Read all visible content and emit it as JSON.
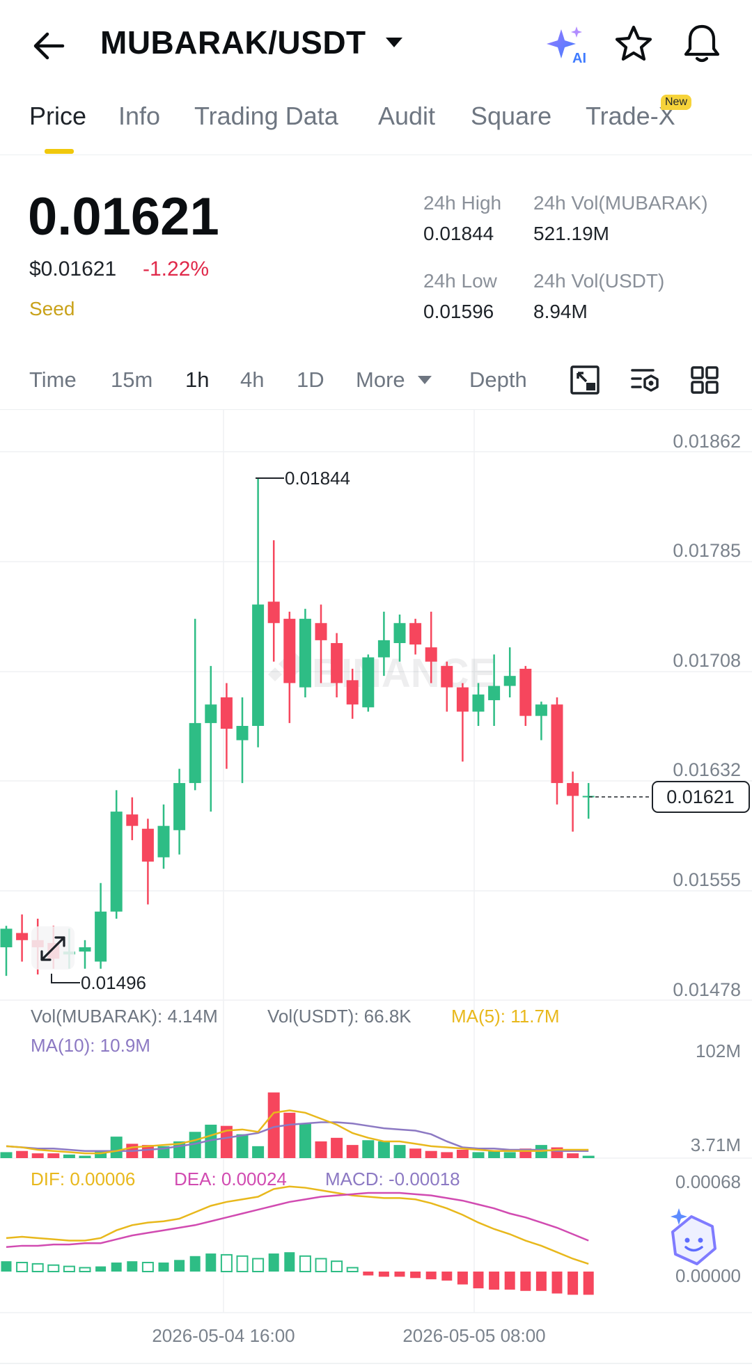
{
  "header": {
    "pair": "MUBARAK/USDT",
    "icons": {
      "back": "back-arrow-icon",
      "ai": "ai-sparkle-icon",
      "favorite": "star-icon",
      "alert": "bell-icon"
    }
  },
  "tabs": [
    {
      "label": "Price",
      "active": true
    },
    {
      "label": "Info"
    },
    {
      "label": "Trading Data"
    },
    {
      "label": "Audit"
    },
    {
      "label": "Square"
    },
    {
      "label": "Trade-X",
      "badge": "New"
    }
  ],
  "ticker": {
    "last_price": "0.01621",
    "usd_price": "$0.01621",
    "change": "-1.22%",
    "tag": "Seed",
    "high_label": "24h High",
    "high": "0.01844",
    "low_label": "24h Low",
    "low": "0.01596",
    "vol_base_label": "24h Vol(MUBARAK)",
    "vol_base": "521.19M",
    "vol_quote_label": "24h Vol(USDT)",
    "vol_quote": "8.94M"
  },
  "intervals": {
    "items": [
      "Time",
      "15m",
      "1h",
      "4h",
      "1D",
      "More"
    ],
    "active": "1h",
    "depth": "Depth",
    "tool_icons": [
      "chart-expand-icon",
      "indicator-settings-icon",
      "grid-layout-icon"
    ]
  },
  "colors": {
    "up": "#2ebd85",
    "down": "#f6465d",
    "ma5": "#e8b81c",
    "ma10": "#8c79c3",
    "dea": "#d14bb1",
    "accent": "#f0c80c"
  },
  "chart_data": {
    "type": "candlestick",
    "price_axis": [
      "0.01862",
      "0.01785",
      "0.01708",
      "0.01632",
      "0.01555",
      "0.01478"
    ],
    "ylim": [
      0.01478,
      0.01862
    ],
    "high_marker": "0.01844",
    "low_marker": "0.01496",
    "current_price": "0.01621",
    "candles": [
      {
        "o": 0.01515,
        "h": 0.0153,
        "l": 0.01495,
        "c": 0.01528
      },
      {
        "o": 0.01525,
        "h": 0.01538,
        "l": 0.01505,
        "c": 0.0152
      },
      {
        "o": 0.0152,
        "h": 0.01535,
        "l": 0.01496,
        "c": 0.01515
      },
      {
        "o": 0.01518,
        "h": 0.0153,
        "l": 0.015,
        "c": 0.01507
      },
      {
        "o": 0.0151,
        "h": 0.01528,
        "l": 0.015,
        "c": 0.01512
      },
      {
        "o": 0.01512,
        "h": 0.0152,
        "l": 0.015,
        "c": 0.01515
      },
      {
        "o": 0.01505,
        "h": 0.0156,
        "l": 0.015,
        "c": 0.0154
      },
      {
        "o": 0.0154,
        "h": 0.01625,
        "l": 0.01535,
        "c": 0.0161
      },
      {
        "o": 0.01608,
        "h": 0.0162,
        "l": 0.0159,
        "c": 0.016
      },
      {
        "o": 0.01598,
        "h": 0.01605,
        "l": 0.01545,
        "c": 0.01575
      },
      {
        "o": 0.01578,
        "h": 0.01615,
        "l": 0.0157,
        "c": 0.016
      },
      {
        "o": 0.01597,
        "h": 0.0164,
        "l": 0.0158,
        "c": 0.0163
      },
      {
        "o": 0.0163,
        "h": 0.01745,
        "l": 0.01625,
        "c": 0.01672
      },
      {
        "o": 0.01672,
        "h": 0.01712,
        "l": 0.0161,
        "c": 0.01685
      },
      {
        "o": 0.0169,
        "h": 0.017,
        "l": 0.0164,
        "c": 0.01668
      },
      {
        "o": 0.0166,
        "h": 0.0169,
        "l": 0.0163,
        "c": 0.0167
      },
      {
        "o": 0.0167,
        "h": 0.01844,
        "l": 0.01655,
        "c": 0.01755
      },
      {
        "o": 0.01757,
        "h": 0.018,
        "l": 0.01715,
        "c": 0.01742
      },
      {
        "o": 0.01745,
        "h": 0.0175,
        "l": 0.01672,
        "c": 0.017
      },
      {
        "o": 0.01697,
        "h": 0.01752,
        "l": 0.0169,
        "c": 0.01745
      },
      {
        "o": 0.01742,
        "h": 0.01755,
        "l": 0.017,
        "c": 0.0173
      },
      {
        "o": 0.01728,
        "h": 0.01735,
        "l": 0.0169,
        "c": 0.017
      },
      {
        "o": 0.01702,
        "h": 0.0171,
        "l": 0.01675,
        "c": 0.01685
      },
      {
        "o": 0.01683,
        "h": 0.0172,
        "l": 0.0168,
        "c": 0.01718
      },
      {
        "o": 0.01718,
        "h": 0.0175,
        "l": 0.01705,
        "c": 0.0173
      },
      {
        "o": 0.01728,
        "h": 0.01748,
        "l": 0.01715,
        "c": 0.01742
      },
      {
        "o": 0.01742,
        "h": 0.01745,
        "l": 0.0172,
        "c": 0.01727
      },
      {
        "o": 0.01725,
        "h": 0.0175,
        "l": 0.017,
        "c": 0.01715
      },
      {
        "o": 0.01712,
        "h": 0.01715,
        "l": 0.0168,
        "c": 0.01697
      },
      {
        "o": 0.01697,
        "h": 0.017,
        "l": 0.01645,
        "c": 0.0168
      },
      {
        "o": 0.0168,
        "h": 0.017,
        "l": 0.0167,
        "c": 0.01692
      },
      {
        "o": 0.01688,
        "h": 0.0172,
        "l": 0.0167,
        "c": 0.01698
      },
      {
        "o": 0.01698,
        "h": 0.01725,
        "l": 0.0169,
        "c": 0.01705
      },
      {
        "o": 0.0171,
        "h": 0.01712,
        "l": 0.0167,
        "c": 0.01677
      },
      {
        "o": 0.01677,
        "h": 0.01687,
        "l": 0.0166,
        "c": 0.01685
      },
      {
        "o": 0.01685,
        "h": 0.0169,
        "l": 0.01615,
        "c": 0.0163
      },
      {
        "o": 0.0163,
        "h": 0.01638,
        "l": 0.01596,
        "c": 0.01621
      },
      {
        "o": 0.0162,
        "h": 0.0163,
        "l": 0.01605,
        "c": 0.01621
      }
    ],
    "volume_legend": {
      "vol_base": "Vol(MUBARAK): 4.14M",
      "vol_quote": "Vol(USDT): 66.8K",
      "ma5": "MA(5): 11.7M",
      "ma10": "MA(10): 10.9M"
    },
    "volume_axis": [
      "102M",
      "3.71M"
    ],
    "volumes_m": [
      5,
      6,
      4,
      4,
      3,
      2,
      6,
      18,
      12,
      11,
      10,
      14,
      22,
      28,
      27,
      20,
      10,
      55,
      38,
      29,
      14,
      17,
      11,
      15,
      14,
      11,
      8,
      6,
      5,
      7,
      5,
      6,
      5,
      8,
      11,
      9,
      4,
      2
    ],
    "ma5_m": [
      10,
      9,
      7,
      6,
      5,
      4,
      4,
      6,
      9,
      10,
      11,
      12,
      15,
      19,
      23,
      24,
      22,
      38,
      40,
      38,
      33,
      28,
      21,
      17,
      14,
      14,
      12,
      10,
      9,
      8,
      7,
      6,
      6,
      6,
      6,
      7,
      7,
      7
    ],
    "ma10_m": [
      10,
      9,
      8,
      8,
      7,
      6,
      6,
      6,
      6,
      7,
      8,
      10,
      12,
      15,
      17,
      19,
      21,
      26,
      28,
      29,
      30,
      30,
      29,
      27,
      25,
      24,
      23,
      20,
      14,
      9,
      8,
      8,
      7,
      7,
      7,
      6,
      6,
      6
    ],
    "macd_legend": {
      "dif": "DIF: 0.00006",
      "dea": "DEA: 0.00024",
      "macd": "MACD: -0.00018"
    },
    "macd_axis": [
      "0.00068",
      "0.00000"
    ],
    "macd_hist": [
      8e-05,
      7e-05,
      6e-05,
      5e-05,
      4e-05,
      3e-05,
      4e-05,
      7e-05,
      8e-05,
      7e-05,
      7e-05,
      9e-05,
      0.00012,
      0.00014,
      0.00013,
      0.00012,
      0.0001,
      0.00014,
      0.00015,
      0.00012,
      0.0001,
      8e-05,
      3e-05,
      -3e-05,
      -4e-05,
      -4e-05,
      -5e-05,
      -6e-05,
      -7e-05,
      -0.0001,
      -0.00013,
      -0.00014,
      -0.00014,
      -0.00015,
      -0.00015,
      -0.00017,
      -0.00018,
      -0.00018
    ],
    "dif": [
      0.00026,
      0.00027,
      0.00026,
      0.00025,
      0.00024,
      0.00024,
      0.00026,
      0.00032,
      0.00036,
      0.00038,
      0.00039,
      0.00041,
      0.00046,
      0.00051,
      0.00054,
      0.00056,
      0.00058,
      0.00064,
      0.00066,
      0.00065,
      0.00063,
      0.00061,
      0.00059,
      0.00058,
      0.00057,
      0.00057,
      0.00056,
      0.00053,
      0.00049,
      0.00044,
      0.00038,
      0.00033,
      0.00029,
      0.00024,
      0.0002,
      0.00015,
      0.0001,
      6e-05
    ],
    "dea": [
      0.00019,
      0.0002,
      0.0002,
      0.00021,
      0.00021,
      0.00022,
      0.00022,
      0.00025,
      0.00028,
      0.0003,
      0.00032,
      0.00034,
      0.00036,
      0.00039,
      0.00042,
      0.00045,
      0.00048,
      0.00051,
      0.00054,
      0.00056,
      0.00058,
      0.00059,
      0.0006,
      0.00061,
      0.00061,
      0.00061,
      0.0006,
      0.00059,
      0.00057,
      0.00055,
      0.00052,
      0.00049,
      0.00045,
      0.00042,
      0.00038,
      0.00034,
      0.00029,
      0.00024
    ],
    "time_axis": [
      "2026-05-04 16:00",
      "2026-05-05 08:00"
    ],
    "watermark": "BINANCE"
  }
}
